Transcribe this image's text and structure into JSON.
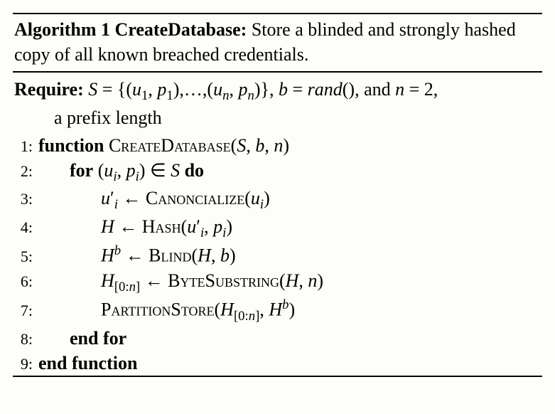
{
  "caption": {
    "label": "Algorithm 1 CreateDatabase:",
    "desc": " Store a blinded and strongly hashed copy of all known breached credentials."
  },
  "require": {
    "label": "Require:",
    "mathline1_html": "  <i>S</i> = {(<i>u</i><sub>1</sub>, <i>p</i><sub>1</sub>),…,(<i>u</i><sub><i>n</i></sub>, <i>p</i><sub><i>n</i></sub>)}, <i>b</i> = <i>rand</i>(), and <i>n</i> = 2,",
    "mathline2": "a prefix length"
  },
  "lines": [
    {
      "n": "1:",
      "indent": "ind1",
      "html": "<b>function</b> <span class=\"sc\">CreateDatabase</span>(<i>S</i>, <i>b</i>, <i>n</i>)"
    },
    {
      "n": "2:",
      "indent": "ind2",
      "html": "<b>for</b> (<i>u</i><sub><i>i</i></sub>, <i>p</i><sub><i>i</i></sub>) ∈ <i>S</i> <b>do</b>"
    },
    {
      "n": "3:",
      "indent": "ind3",
      "html": "<i>u</i>′<sub><i>i</i></sub> ← <span class=\"sc\">Canoncialize</span>(<i>u</i><sub><i>i</i></sub>)"
    },
    {
      "n": "4:",
      "indent": "ind3",
      "html": "<i>H</i> ← <span class=\"sc\">Hash</span>(<i>u</i>′<sub><i>i</i></sub>, <i>p</i><sub><i>i</i></sub>)"
    },
    {
      "n": "5:",
      "indent": "ind3",
      "html": "<i>H</i><sup><i>b</i></sup> ← <span class=\"sc\">Blind</span>(<i>H</i>, <i>b</i>)"
    },
    {
      "n": "6:",
      "indent": "ind3",
      "html": "<i>H</i><sub>[0:<i>n</i>]</sub> ← <span class=\"sc\">ByteSubstring</span>(<i>H</i>, <i>n</i>)"
    },
    {
      "n": "7:",
      "indent": "ind3",
      "html": "<span class=\"sc\">PartitionStore</span>(<i>H</i><sub>[0:<i>n</i>]</sub>, <i>H</i><sup><i>b</i></sup>)"
    },
    {
      "n": "8:",
      "indent": "ind2",
      "html": "<b>end for</b>"
    },
    {
      "n": "9:",
      "indent": "ind1",
      "html": "<b>end function</b>"
    }
  ]
}
